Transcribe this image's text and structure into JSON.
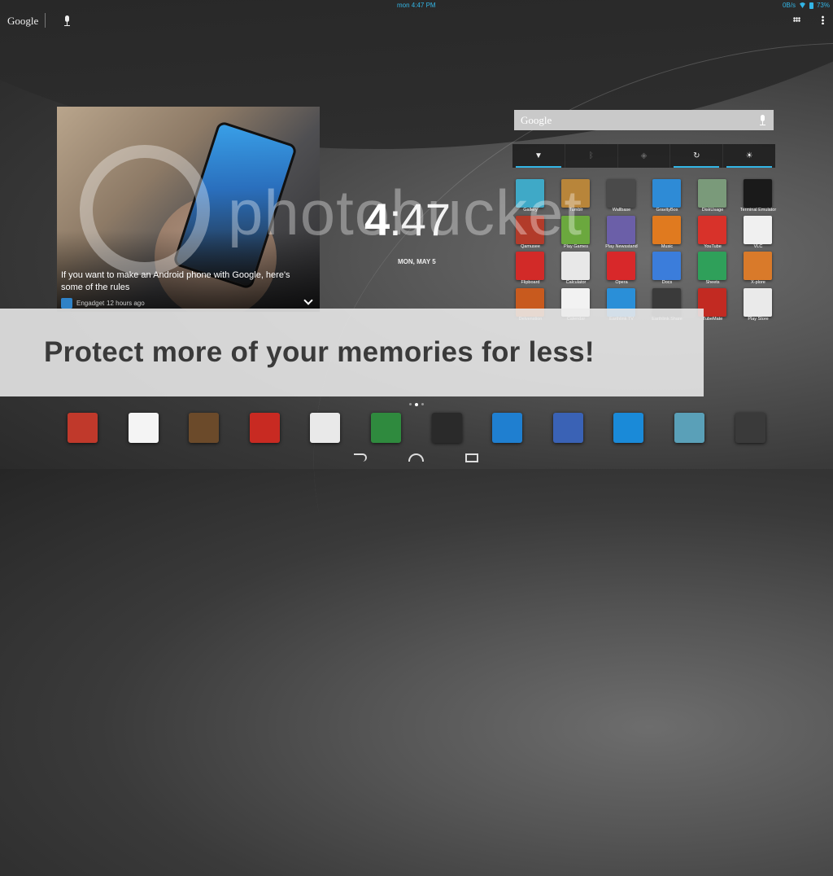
{
  "status_bar": {
    "time": "mon 4:47 PM",
    "data_rate": "0B/s",
    "battery": "73%"
  },
  "search": {
    "logo": "Google"
  },
  "news_card": {
    "headline": "If you want to make an Android phone with Google, here's some of the rules",
    "source": "Engadget",
    "time_ago": "12 hours ago"
  },
  "clock": {
    "hours": "4",
    "minutes": ":47",
    "date": "MON, MAY 5"
  },
  "google_widget": {
    "logo": "Google"
  },
  "power_control": [
    {
      "icon": "wifi-icon",
      "glyph": "▼",
      "state": "on"
    },
    {
      "icon": "bluetooth-icon",
      "glyph": "ᛒ",
      "state": "off"
    },
    {
      "icon": "gps-icon",
      "glyph": "◈",
      "state": "off"
    },
    {
      "icon": "sync-icon",
      "glyph": "↻",
      "state": "on"
    },
    {
      "icon": "brightness-icon",
      "glyph": "☀",
      "state": "on"
    }
  ],
  "apps": [
    {
      "label": "Gallery",
      "color": "#3fa9c7"
    },
    {
      "label": "Tumblr",
      "color": "#b8853a"
    },
    {
      "label": "Wallbase",
      "color": "#4a4a4a"
    },
    {
      "label": "GravityBox",
      "color": "#2e8bd6"
    },
    {
      "label": "DiskUsage",
      "color": "#7a9a7a"
    },
    {
      "label": "Terminal Emulator",
      "color": "#1a1a1a"
    },
    {
      "label": "Qamusee",
      "color": "#b23b2a"
    },
    {
      "label": "Play Games",
      "color": "#6ba83e"
    },
    {
      "label": "Play Newsstand",
      "color": "#6b5fa8"
    },
    {
      "label": "Music",
      "color": "#e07a1f"
    },
    {
      "label": "YouTube",
      "color": "#d8322a"
    },
    {
      "label": "VLC",
      "color": "#f0f0f0"
    },
    {
      "label": "Flipboard",
      "color": "#d22a28"
    },
    {
      "label": "Calculator",
      "color": "#e8e8e8"
    },
    {
      "label": "Opera",
      "color": "#d8282a"
    },
    {
      "label": "Docs",
      "color": "#3b7ddb"
    },
    {
      "label": "Sheets",
      "color": "#2fa05a"
    },
    {
      "label": "X-plore",
      "color": "#d97a2a"
    },
    {
      "label": "Delvenstion",
      "color": "#c85a1e"
    },
    {
      "label": "Calendar",
      "color": "#f2f2f2"
    },
    {
      "label": "Earthlink TV",
      "color": "#2a8fd8"
    },
    {
      "label": "Earthlink Share",
      "color": "#3a3a3a"
    },
    {
      "label": "TubeMate",
      "color": "#c22a22"
    },
    {
      "label": "Play Store",
      "color": "#eaeaea"
    }
  ],
  "watermark": {
    "text": "photobucket"
  },
  "banner": {
    "text": "Protect more of your memories for less!"
  },
  "dock": [
    {
      "icon": "chrome-icon",
      "color": "#c0392b"
    },
    {
      "icon": "gmail-icon",
      "color": "#f4f4f4"
    },
    {
      "icon": "book-reader-icon",
      "color": "#6b4a2a"
    },
    {
      "icon": "adobe-reader-icon",
      "color": "#c82a22"
    },
    {
      "icon": "onedrive-icon",
      "color": "#e9e9e9"
    },
    {
      "icon": "google-drive-icon",
      "color": "#2f8a3e"
    },
    {
      "icon": "media-player-icon",
      "color": "#2a2a2a"
    },
    {
      "icon": "quickpic-icon",
      "color": "#1f7fd0"
    },
    {
      "icon": "browser-icon",
      "color": "#3a62b5"
    },
    {
      "icon": "es-file-explorer-icon",
      "color": "#1a8ad8"
    },
    {
      "icon": "file-manager-icon",
      "color": "#5aa0b8"
    },
    {
      "icon": "settings-sliders-icon",
      "color": "#3a3a3a"
    }
  ],
  "pager": {
    "pages": 3,
    "active": 1
  }
}
